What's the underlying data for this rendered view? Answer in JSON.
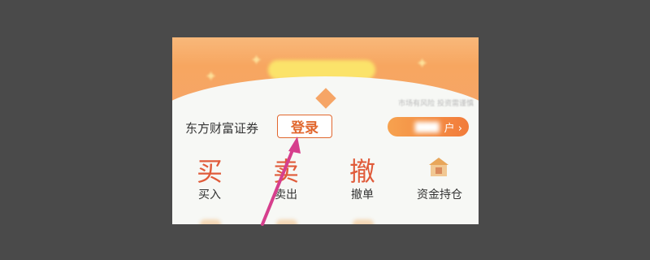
{
  "banner": {
    "pill_text": "",
    "disclaimer": "市场有风险 投资需谨慎"
  },
  "header": {
    "broker_name": "东方财富证券",
    "login_label": "登录",
    "open_account_label": "户 ›"
  },
  "menu": {
    "items": [
      {
        "icon_char": "买",
        "label": "买入"
      },
      {
        "icon_char": "卖",
        "label": "卖出"
      },
      {
        "icon_char": "撤",
        "label": "撤单"
      },
      {
        "icon_char": "",
        "label": "资金持仓"
      }
    ]
  },
  "colors": {
    "accent": "#e1672e",
    "icon_red": "#e05b3a",
    "annotation_arrow": "#d63f8d"
  }
}
